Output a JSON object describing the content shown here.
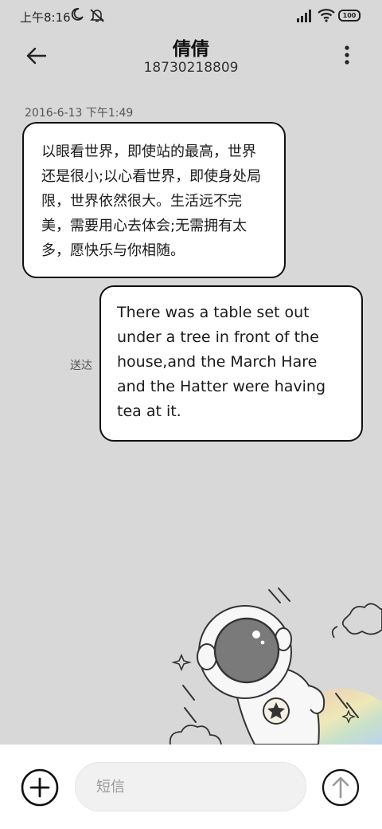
{
  "status_bar": {
    "time": "上午8:16",
    "battery": "100",
    "icons": [
      "moon-icon",
      "mute-icon",
      "signal-icon",
      "wifi-icon",
      "battery-icon"
    ]
  },
  "header": {
    "contact_name": "倩倩",
    "contact_number": "18730218809",
    "icons": [
      "back-arrow-icon",
      "more-vertical-icon"
    ]
  },
  "conversation": {
    "timestamp": "2016-6-13 下午1:49",
    "incoming_message": "以眼看世界，即使站的最高，世界还是很小;以心看世界，即使身处局限，世界依然很大。生活远不完美，需要用心去体会;无需拥有太多，愿快乐与你相随。",
    "outgoing_message": "There was a table set out under a tree in front of the house,and the March Hare and the Hatter were having tea at it.",
    "delivery_status": "送达"
  },
  "composer": {
    "placeholder": "短信",
    "value": "",
    "icons": [
      "plus-icon",
      "send-arrow-icon"
    ]
  },
  "colors": {
    "background": "#d8d8d8",
    "bubble": "#ffffff",
    "border": "#111111",
    "composer_bar": "#ffffff"
  }
}
